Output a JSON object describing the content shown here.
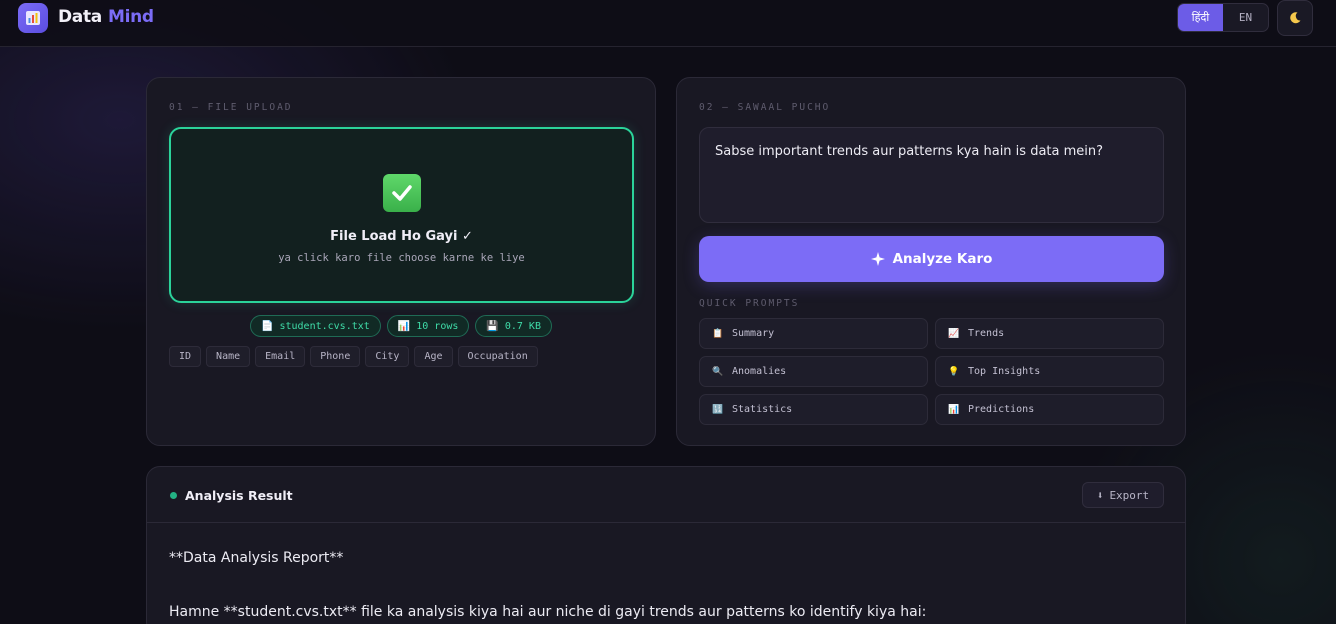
{
  "header": {
    "brand_part1": "Data",
    "brand_part2": "Mind",
    "lang_hindi": "हिंदी",
    "lang_en": "EN",
    "theme_icon": "moon-icon"
  },
  "upload": {
    "label": "01 — FILE UPLOAD",
    "status_title": "File Load Ho Gayi ✓",
    "status_sub": "ya click karo file choose karne ke liye",
    "file_name": "student.cvs.txt",
    "rows": "10 rows",
    "size": "0.7 KB",
    "columns": [
      "ID",
      "Name",
      "Email",
      "Phone",
      "City",
      "Age",
      "Occupation"
    ]
  },
  "question": {
    "label": "02 — SAWAAL PUCHO",
    "text": "Sabse important trends aur patterns kya hain is data mein?",
    "analyze_label": "Analyze Karo",
    "quick_label": "QUICK PROMPTS",
    "prompts": [
      "Summary",
      "Trends",
      "Anomalies",
      "Top Insights",
      "Statistics",
      "Predictions"
    ]
  },
  "result": {
    "title": "Analysis Result",
    "export_label": "Export",
    "line1": "**Data Analysis Report**",
    "line2": "Hamne **student.cvs.txt** file ka analysis kiya hai aur niche di gayi trends aur patterns ko identify kiya hai:"
  },
  "colors": {
    "accent": "#7c6cf6",
    "success": "#2bd39a"
  }
}
